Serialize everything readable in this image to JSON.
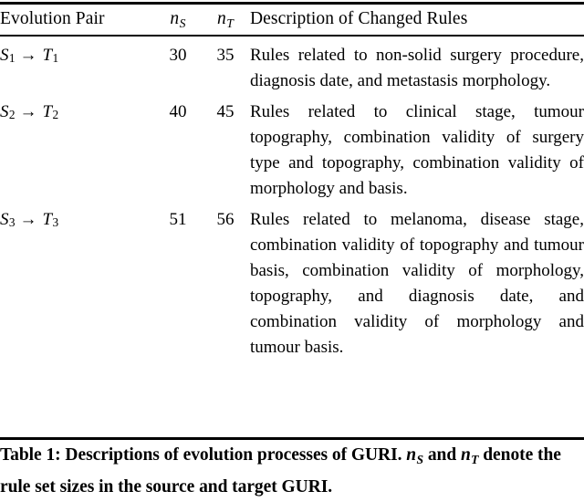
{
  "table": {
    "number": "1",
    "columns": [
      {
        "id": "evolution_pair",
        "label": "Evolution Pair"
      },
      {
        "id": "n_s",
        "label_base": "n",
        "label_sub": "S"
      },
      {
        "id": "n_t",
        "label_base": "n",
        "label_sub": "T"
      },
      {
        "id": "description",
        "label": "Description of Changed Rules"
      }
    ],
    "rows": [
      {
        "pair_source": "S",
        "pair_source_sub": "1",
        "pair_arrow": "→",
        "pair_target": "T",
        "pair_target_sub": "1",
        "n_s": "30",
        "n_t": "35",
        "description": "Rules related to non-solid surgery procedure, diagnosis date, and metastasis morphology."
      },
      {
        "pair_source": "S",
        "pair_source_sub": "2",
        "pair_arrow": "→",
        "pair_target": "T",
        "pair_target_sub": "2",
        "n_s": "40",
        "n_t": "45",
        "description": "Rules related to clinical stage, tumour topography, combination validity of surgery type and topography, combination validity of morphology and basis."
      },
      {
        "pair_source": "S",
        "pair_source_sub": "3",
        "pair_arrow": "→",
        "pair_target": "T",
        "pair_target_sub": "3",
        "n_s": "51",
        "n_t": "56",
        "description": "Rules related to melanoma, disease stage, combination validity of topography and tumour basis, combination validity of morphology, topography, and diagnosis date, and combination validity of morphology and tumour basis."
      }
    ]
  },
  "caption": {
    "prefix": "Table 1: Descriptions of evolution processes of GURI.",
    "mid": "and",
    "suffix": "denote the rule set sizes in the source and target GURI.",
    "sym1_base": "n",
    "sym1_sub": "S",
    "sym2_base": "n",
    "sym2_sub": "T"
  },
  "style": {
    "text_color": "#000000",
    "background": "#ffffff",
    "rule_color": "#000000"
  }
}
